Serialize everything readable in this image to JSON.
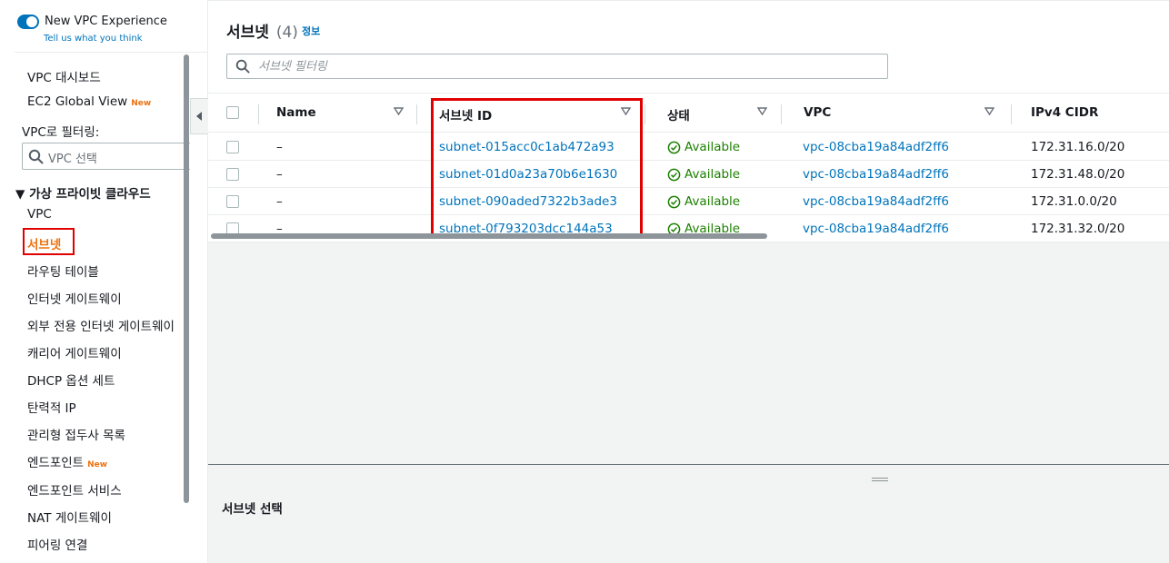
{
  "sidebar": {
    "toggle_label": "New VPC Experience",
    "toggle_link": "Tell us what you think",
    "dashboard": "VPC 대시보드",
    "global_view": "EC2 Global View",
    "new_badge": "New",
    "filter_label": "VPC로 필터링:",
    "vpc_select_placeholder": "VPC 선택",
    "section_title": "▼ 가상 프라이빗 클라우드",
    "items": [
      {
        "label": "VPC"
      },
      {
        "label": "서브넷",
        "active": true
      },
      {
        "label": "라우팅 테이블"
      },
      {
        "label": "인터넷 게이트웨이"
      },
      {
        "label": "외부 전용 인터넷 게이트웨이"
      },
      {
        "label": "캐리어 게이트웨이"
      },
      {
        "label": "DHCP 옵션 세트"
      },
      {
        "label": "탄력적 IP"
      },
      {
        "label": "관리형 접두사 목록"
      },
      {
        "label": "엔드포인트",
        "badge": "New"
      },
      {
        "label": "엔드포인트 서비스"
      },
      {
        "label": "NAT 게이트웨이"
      },
      {
        "label": "피어링 연결"
      }
    ]
  },
  "header": {
    "title": "서브넷",
    "count": "(4)",
    "info": "정보",
    "filter_placeholder": "서브넷 필터링"
  },
  "table": {
    "columns": [
      "Name",
      "서브넷 ID",
      "상태",
      "VPC",
      "IPv4 CIDR"
    ],
    "rows": [
      {
        "name": "–",
        "subnet_id": "subnet-015acc0c1ab472a93",
        "status": "Available",
        "vpc": "vpc-08cba19a84adf2ff6",
        "cidr": "172.31.16.0/20"
      },
      {
        "name": "–",
        "subnet_id": "subnet-01d0a23a70b6e1630",
        "status": "Available",
        "vpc": "vpc-08cba19a84adf2ff6",
        "cidr": "172.31.48.0/20"
      },
      {
        "name": "–",
        "subnet_id": "subnet-090aded7322b3ade3",
        "status": "Available",
        "vpc": "vpc-08cba19a84adf2ff6",
        "cidr": "172.31.0.0/20"
      },
      {
        "name": "–",
        "subnet_id": "subnet-0f793203dcc144a53",
        "status": "Available",
        "vpc": "vpc-08cba19a84adf2ff6",
        "cidr": "172.31.32.0/20"
      }
    ]
  },
  "split_panel": {
    "title": "서브넷 선택"
  },
  "colors": {
    "link": "#0073bb",
    "available": "#1d8102",
    "active_nav": "#ec7211",
    "highlight": "#e00000"
  }
}
